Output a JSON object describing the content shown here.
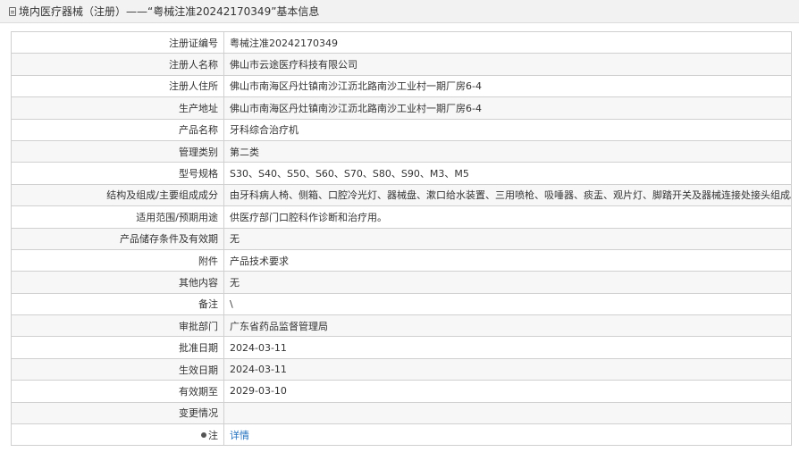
{
  "header": {
    "title": "境内医疗器械（注册）——“粤械注准20242170349”基本信息"
  },
  "rows": [
    {
      "label": "注册证编号",
      "value": "粤械注准20242170349"
    },
    {
      "label": "注册人名称",
      "value": "佛山市云途医疗科技有限公司"
    },
    {
      "label": "注册人住所",
      "value": "佛山市南海区丹灶镇南沙江沥北路南沙工业村一期厂房6-4"
    },
    {
      "label": "生产地址",
      "value": "佛山市南海区丹灶镇南沙江沥北路南沙工业村一期厂房6-4"
    },
    {
      "label": "产品名称",
      "value": "牙科综合治疗机"
    },
    {
      "label": "管理类别",
      "value": "第二类"
    },
    {
      "label": "型号规格",
      "value": "S30、S40、S50、S60、S70、S80、S90、M3、M5"
    },
    {
      "label": "结构及组成/主要组成成分",
      "value": "由牙科病人椅、侧箱、口腔冷光灯、器械盘、漱口给水装置、三用喷枪、吸唾器、痰盂、观片灯、脚踏开关及器械连接处接头组成。"
    },
    {
      "label": "适用范围/预期用途",
      "value": "供医疗部门口腔科作诊断和治疗用。"
    },
    {
      "label": "产品储存条件及有效期",
      "value": "无"
    },
    {
      "label": "附件",
      "value": "产品技术要求"
    },
    {
      "label": "其他内容",
      "value": "无"
    },
    {
      "label": "备注",
      "value": "\\"
    },
    {
      "label": "审批部门",
      "value": "广东省药品监督管理局"
    },
    {
      "label": "批准日期",
      "value": "2024-03-11"
    },
    {
      "label": "生效日期",
      "value": "2024-03-11"
    },
    {
      "label": "有效期至",
      "value": "2029-03-10"
    },
    {
      "label": "变更情况",
      "value": ""
    }
  ],
  "note_row": {
    "label": "注",
    "link_text": "详情"
  },
  "colors": {
    "link": "#1f6fbf",
    "border": "#d0d0d0",
    "header_bg": "#f2f2f2"
  }
}
